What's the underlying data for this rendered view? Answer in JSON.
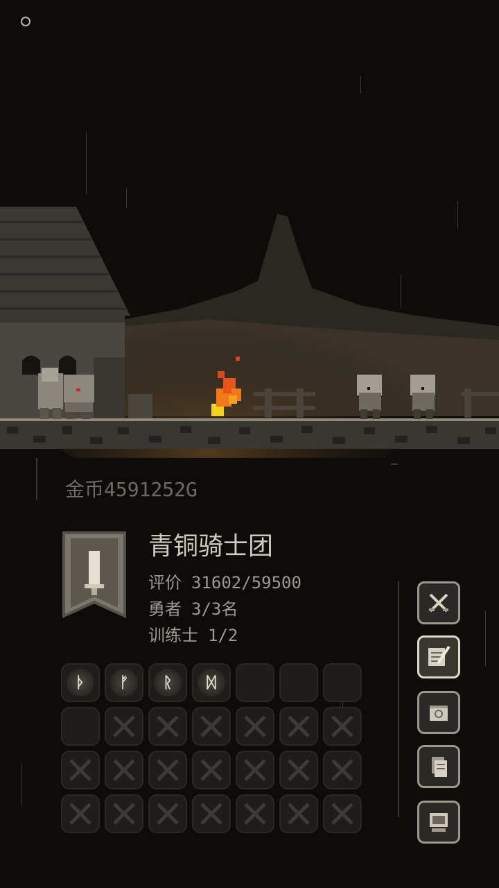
{
  "hud": {
    "gold_text": "金币4591252G"
  },
  "guild": {
    "name": "青铜骑士团",
    "rating_label": "评价",
    "rating_value": "31602/59500",
    "heroes_label": "勇者",
    "heroes_value": "3/3名",
    "trainers_label": "训练士",
    "trainers_value": "1/2"
  },
  "runes": [
    "ᚦ",
    "ᚠ",
    "ᚱ",
    "ᛞ"
  ],
  "side_menu": [
    {
      "name": "battle-icon",
      "active": false
    },
    {
      "name": "quest-scroll-icon",
      "active": true
    },
    {
      "name": "map-icon",
      "active": false
    },
    {
      "name": "documents-icon",
      "active": false
    },
    {
      "name": "computer-icon",
      "active": false
    }
  ],
  "colors": {
    "background": "#0d0c0b",
    "text_primary": "#cfcabe",
    "text_secondary": "#9e998f",
    "fire": "#f07a1a"
  }
}
